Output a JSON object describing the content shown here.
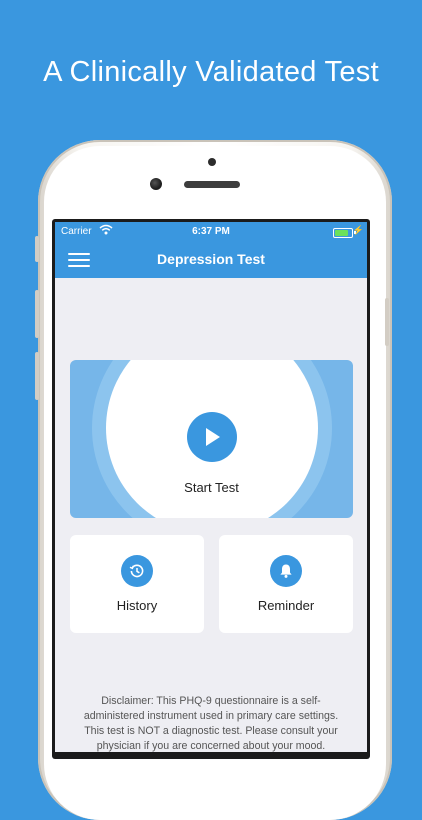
{
  "headline": "A Clinically Validated Test",
  "status_bar": {
    "carrier": "Carrier",
    "time": "6:37 PM",
    "battery_color": "#6be15a",
    "battery_level": 0.8
  },
  "nav": {
    "title": "Depression Test",
    "menu_icon": "hamburger-icon"
  },
  "hero": {
    "label": "Start Test",
    "icon": "play-icon"
  },
  "cards": [
    {
      "label": "History",
      "icon": "history-icon"
    },
    {
      "label": "Reminder",
      "icon": "bell-icon"
    }
  ],
  "disclaimer": "Disclaimer: This PHQ-9 questionnaire is a self-administered instrument used in primary care settings. This test is NOT a diagnostic test. Please consult your physician if you are concerned about your mood.",
  "colors": {
    "background": "#3a97df",
    "accent": "#3a97df",
    "screen_bg": "#eeeef3"
  }
}
